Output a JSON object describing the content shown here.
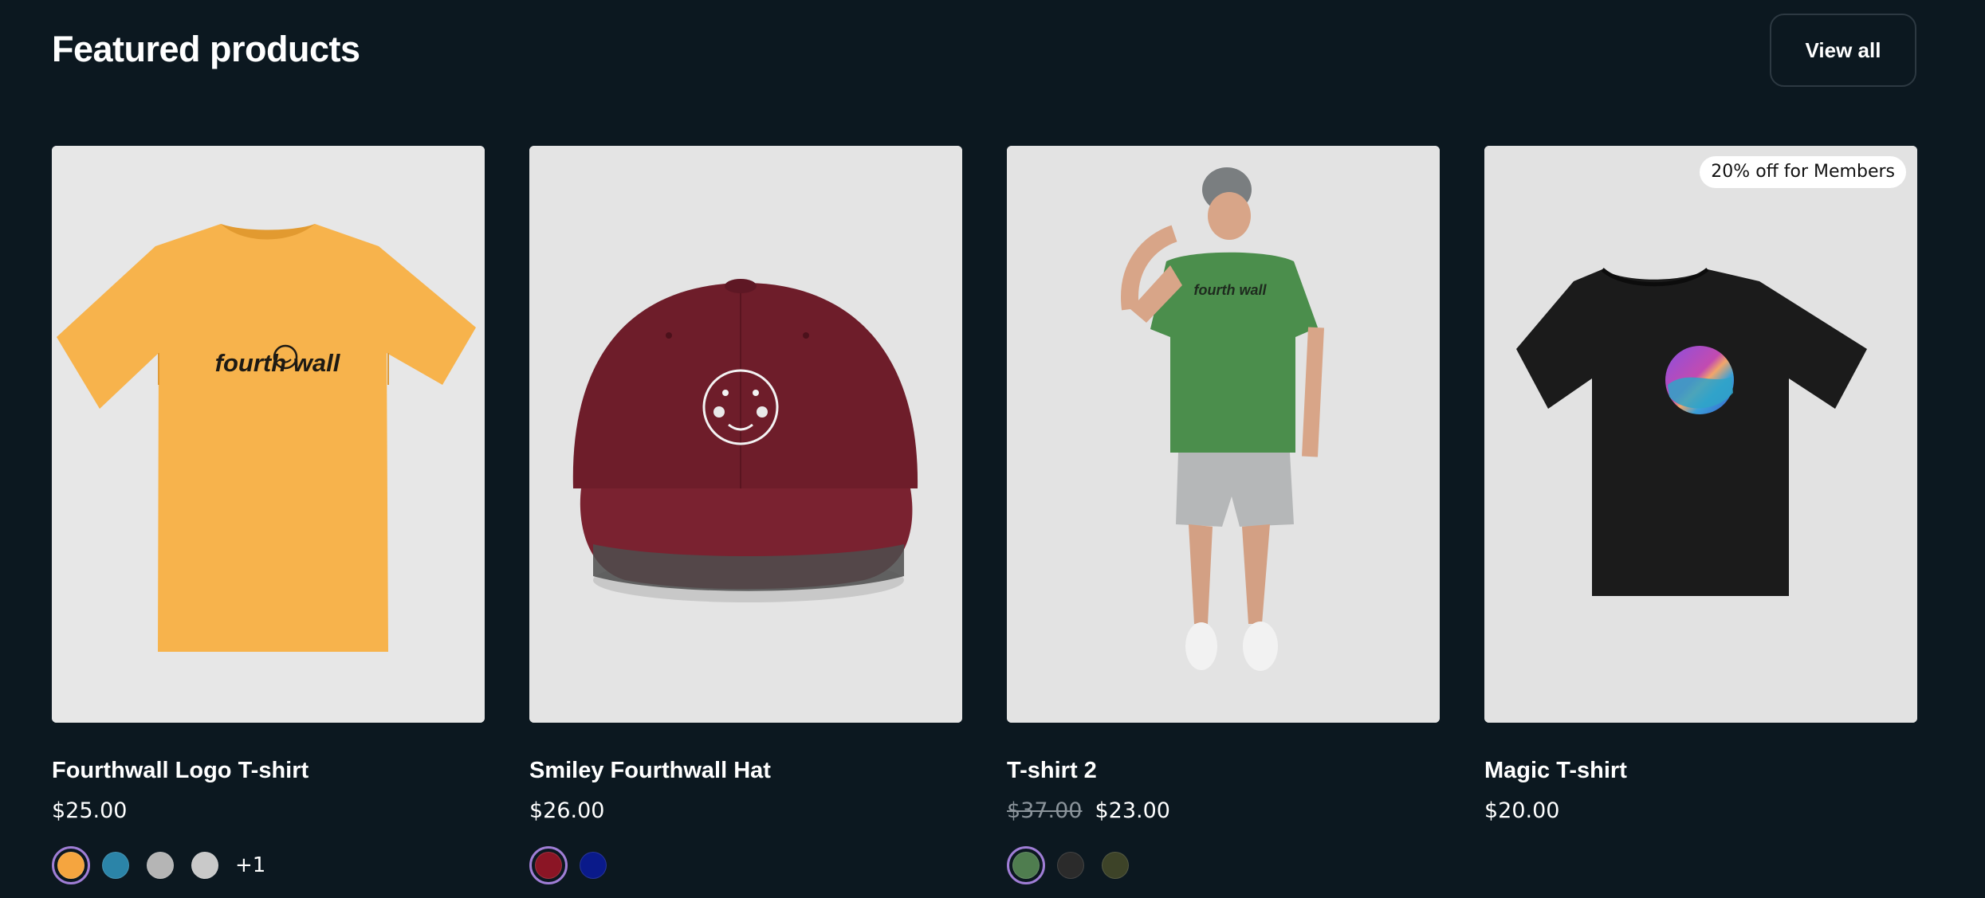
{
  "header": {
    "title": "Featured products",
    "view_all_label": "View all"
  },
  "products": [
    {
      "name": "Fourthwall Logo T-shirt",
      "price": "$25.00",
      "image": "yellow-tshirt-fourthwall-logo",
      "swatches": [
        "#f5a53f",
        "#2b84a8",
        "#b5b5b5",
        "#c9c9c9"
      ],
      "more_colors": "+1",
      "selected_color": "#f5a53f"
    },
    {
      "name": "Smiley Fourthwall Hat",
      "price": "$26.00",
      "image": "maroon-cap-smiley",
      "swatches": [
        "#8b1525",
        "#0a1a8a"
      ],
      "selected_color": "#8b1525"
    },
    {
      "name": "T-shirt 2",
      "price_original": "$37.00",
      "price": "$23.00",
      "image": "man-green-tshirt",
      "swatches": [
        "#4f7d4f",
        "#2b2b2b",
        "#3d4328"
      ],
      "selected_color": "#4f7d4f"
    },
    {
      "name": "Magic T-shirt",
      "price": "$20.00",
      "image": "black-tshirt-gradient-circle",
      "badge": "20% off for Members"
    }
  ],
  "colors": {
    "background": "#0c1820",
    "card_image_bg": "#e6e6e6",
    "selected_ring": "#a07ed6",
    "strikethrough_price": "#8a939a"
  }
}
